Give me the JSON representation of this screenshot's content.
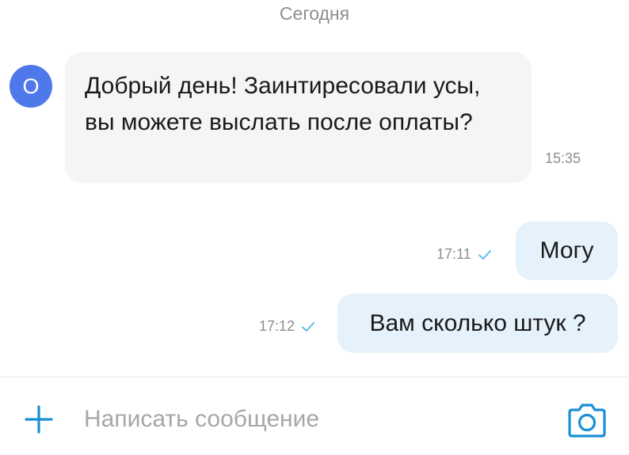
{
  "chat": {
    "date_separator": "Сегодня",
    "incoming": {
      "avatar_letter": "О",
      "text": "Добрый день! Заинтиресовали усы, вы можете выслать после оплаты?",
      "time": "15:35"
    },
    "outgoing": [
      {
        "text": "Могу",
        "time": "17:11",
        "status": "sent-check"
      },
      {
        "text": "Вам сколько штук ?",
        "time": "17:12",
        "status": "sent-check"
      }
    ]
  },
  "composer": {
    "placeholder": "Написать сообщение",
    "value": ""
  },
  "icons": {
    "attach": "plus-icon",
    "camera": "camera-icon",
    "status": "check-icon"
  },
  "colors": {
    "accent": "#1a8fd6",
    "avatar": "#4f78ea",
    "incoming_bubble": "#f5f5f5",
    "outgoing_bubble": "#e5f2fc",
    "check": "#5bc0ea"
  }
}
